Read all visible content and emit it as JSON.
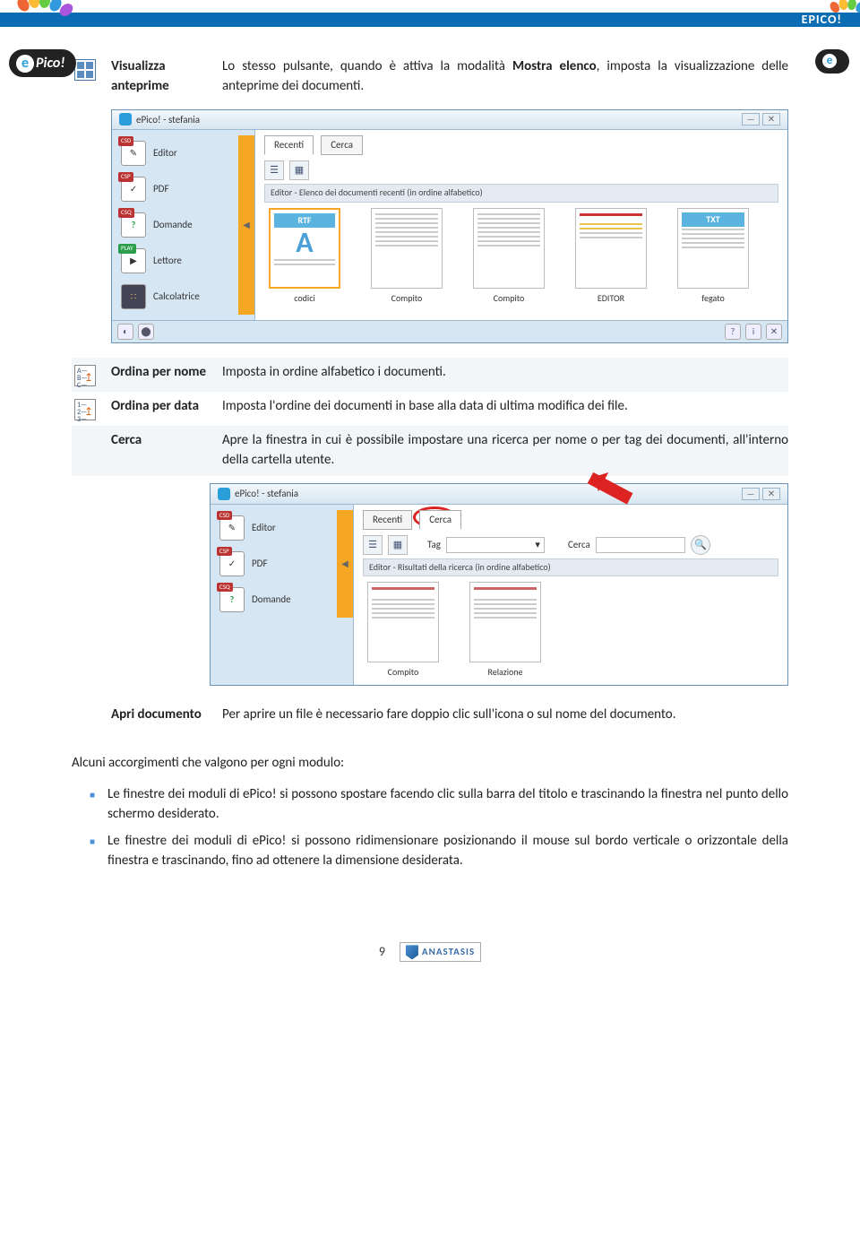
{
  "header": {
    "brand": "ePico!",
    "label_right": "EPICO!"
  },
  "rows": {
    "r1": {
      "label": "Visualizza anteprime",
      "desc_a": "Lo stesso pulsante, quando è attiva la modalità ",
      "desc_b": "Mostra elenco",
      "desc_c": ", imposta la visualizzazione delle anteprime dei documenti."
    },
    "r2": {
      "label": "Ordina per nome",
      "desc": "Imposta in ordine alfabetico i documenti."
    },
    "r3": {
      "label": "Ordina per data",
      "desc": "Imposta l'ordine dei documenti in base alla data di ultima modifica dei file."
    },
    "r4": {
      "label": "Cerca",
      "desc": "Apre la finestra in cui è possibile impostare una ricerca per nome o per tag dei documenti, all'interno della cartella utente."
    },
    "r5": {
      "label": "Apri documento",
      "desc": "Per aprire un file è necessario fare doppio clic sull'icona o sul nome del documento."
    }
  },
  "mock1": {
    "title": "ePico! - stefania",
    "side": [
      "Editor",
      "PDF",
      "Domande",
      "Lettore",
      "Calcolatrice"
    ],
    "side_tags": [
      "CSD",
      "CSP",
      "CSQ",
      "PLAY",
      ""
    ],
    "tabs": [
      "Recenti",
      "Cerca"
    ],
    "panel": "Editor - Elenco dei documenti recenti (in ordine alfabetico)",
    "thumbs": [
      {
        "name": "codici",
        "badge": "RTF",
        "sel": true
      },
      {
        "name": "Compito"
      },
      {
        "name": "Compito"
      },
      {
        "name": "EDITOR"
      },
      {
        "name": "fegato",
        "badge": "TXT"
      }
    ]
  },
  "mock2": {
    "title": "ePico! - stefania",
    "side": [
      "Editor",
      "PDF",
      "Domande"
    ],
    "side_tags": [
      "CSD",
      "CSP",
      "CSQ"
    ],
    "tabs": [
      "Recenti",
      "Cerca"
    ],
    "tag_label": "Tag",
    "search_label": "Cerca",
    "panel": "Editor - Risultati della ricerca (in ordine alfabetico)",
    "thumbs": [
      {
        "name": "Compito"
      },
      {
        "name": "Relazione"
      }
    ]
  },
  "bottom": {
    "intro": "Alcuni accorgimenti che valgono per ogni modulo:",
    "b1": "Le finestre dei moduli di ePico! si possono spostare facendo clic sulla barra del titolo e trascinando la finestra nel punto dello schermo desiderato.",
    "b2": "Le finestre dei moduli di ePico! si possono ridimensionare posizionando il mouse sul bordo verticale o orizzontale della finestra e trascinando, fino ad ottenere la dimensione desiderata."
  },
  "footer": {
    "page": "9",
    "brand": "ANASTASIS"
  }
}
